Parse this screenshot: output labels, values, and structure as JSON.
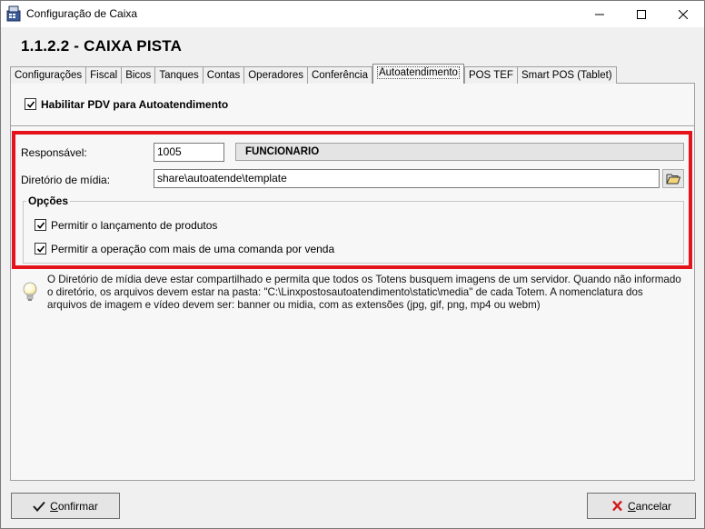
{
  "window": {
    "title": "Configuração de Caixa",
    "icon": "cash-register-icon"
  },
  "header": {
    "title": "1.1.2.2 - CAIXA PISTA"
  },
  "tabs": [
    {
      "label": "Configurações"
    },
    {
      "label": "Fiscal"
    },
    {
      "label": "Bicos"
    },
    {
      "label": "Tanques"
    },
    {
      "label": "Contas"
    },
    {
      "label": "Operadores"
    },
    {
      "label": "Conferência"
    },
    {
      "label": "Autoatendimento",
      "active": true
    },
    {
      "label": "POS TEF"
    },
    {
      "label": "Smart POS (Tablet)"
    }
  ],
  "autoatendimento": {
    "enable_label": "Habilitar PDV para Autoatendimento",
    "enable_checked": true,
    "responsavel_label": "Responsável:",
    "responsavel_code": "1005",
    "responsavel_name": "FUNCIONARIO",
    "diretorio_label": "Diretório de mídia:",
    "diretorio_value": "share\\autoatende\\template",
    "opcoes": {
      "title": "Opções",
      "opt1_label": "Permitir o lançamento de produtos",
      "opt1_checked": true,
      "opt2_label": "Permitir a operação com mais de uma comanda por venda",
      "opt2_checked": true
    },
    "info_text": "O Diretório de mídia deve estar compartilhado e permita que todos os Totens busquem imagens de um servidor. Quando não informado o diretório, os arquivos devem estar na pasta: \"C:\\Linxpostosautoatendimento\\static\\media\" de cada Totem. A nomenclatura dos arquivos de imagem e vídeo devem ser: banner ou midia, com as extensões (jpg, gif, png, mp4 ou webm)"
  },
  "buttons": {
    "confirm_first": "C",
    "confirm_rest": "onfirmar",
    "cancel_first": "C",
    "cancel_rest": "ancelar"
  },
  "colors": {
    "highlight": "#e3121b"
  }
}
